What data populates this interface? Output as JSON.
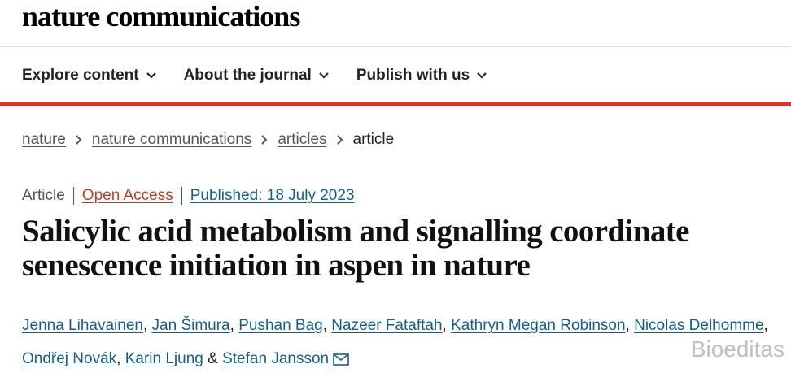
{
  "header": {
    "logo": "nature communications"
  },
  "nav": {
    "items": [
      {
        "label": "Explore content",
        "icon": "chevron-down-icon"
      },
      {
        "label": "About the journal",
        "icon": "chevron-down-icon"
      },
      {
        "label": "Publish with us",
        "icon": "chevron-down-icon"
      }
    ]
  },
  "colors": {
    "accent_bar": "#e0312b",
    "link": "#155d8f",
    "open_access": "#b53f2a"
  },
  "breadcrumb": {
    "items": [
      "nature",
      "nature communications",
      "articles"
    ],
    "current": "article"
  },
  "article": {
    "type": "Article",
    "open_access": "Open Access",
    "published": "Published: 18 July 2023",
    "title": "Salicylic acid metabolism and signalling coordinate senescence initiation in aspen in nature",
    "authors": [
      "Jenna Lihavainen",
      "Jan Šimura",
      "Pushan Bag",
      "Nazeer Fataftah",
      "Kathryn Megan Robinson",
      "Nicolas Delhomme",
      "Ondřej Novák",
      "Karin Ljung",
      "Stefan Jansson"
    ],
    "author_separator": ",",
    "author_and": "&",
    "corresponding_icon": "mail-icon"
  },
  "watermark": "Bioeditas"
}
